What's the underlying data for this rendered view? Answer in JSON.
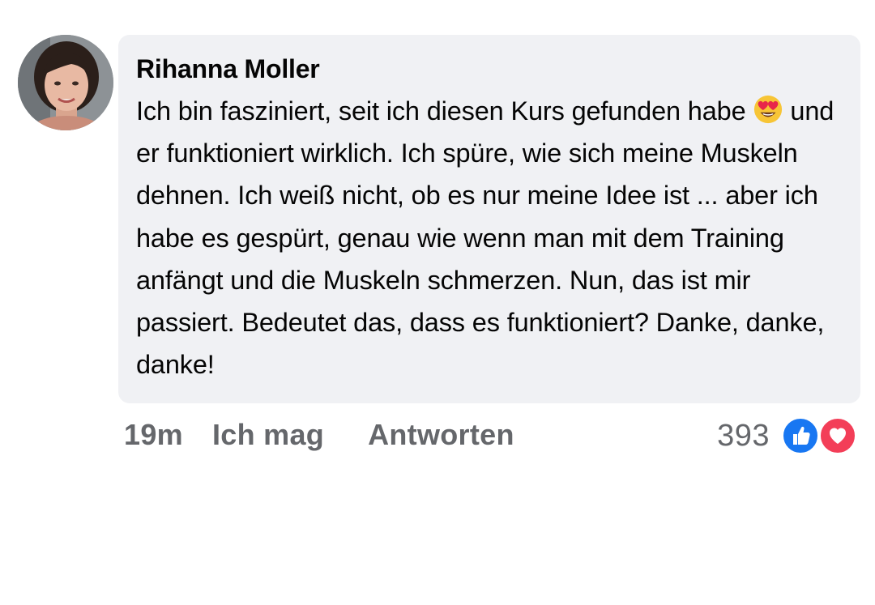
{
  "comment": {
    "author": "Rihanna Moller",
    "text_parts": [
      "Ich bin fasziniert, seit ich diesen Kurs gefunden habe",
      "und er funktioniert wirklich. Ich spüre, wie sich meine Muskeln dehnen. Ich weiß nicht, ob es nur meine Idee ist ... aber ich habe es gespürt, genau wie wenn man mit dem Training anfängt und die Muskeln schmerzen. Nun, das ist mir passiert. Bedeutet das, dass es funktioniert? Danke, danke, danke!"
    ],
    "emoji": "heart-eyes-emoji"
  },
  "actions": {
    "time": "19m",
    "like_label": "Ich mag",
    "reply_label": "Antworten"
  },
  "reactions": {
    "count": "393",
    "types": [
      "like-icon",
      "love-icon"
    ]
  },
  "colors": {
    "bubble_bg": "#f0f1f4",
    "meta_text": "#65676b",
    "like_blue": "#1877f2",
    "love_red": "#f33e58"
  }
}
